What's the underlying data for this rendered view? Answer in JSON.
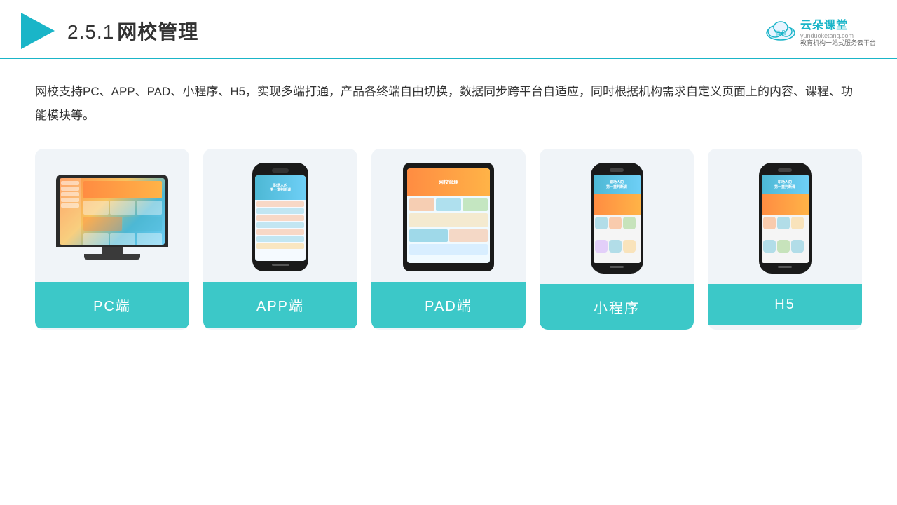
{
  "header": {
    "section": "2.5.1",
    "title": "网校管理",
    "brand_name": "云朵课堂",
    "brand_slogan": "教育机构一站\n式服务云平台",
    "brand_url": "yunduoketang.com"
  },
  "description": {
    "text": "网校支持PC、APP、PAD、小程序、H5，实现多端打通，产品各终端自由切换，数据同步跨平台自适应，同时根据机构需求自定义页面上的内容、课程、功能模块等。"
  },
  "cards": [
    {
      "id": "pc",
      "label": "PC端"
    },
    {
      "id": "app",
      "label": "APP端"
    },
    {
      "id": "pad",
      "label": "PAD端"
    },
    {
      "id": "miniapp",
      "label": "小程序"
    },
    {
      "id": "h5",
      "label": "H5"
    }
  ]
}
